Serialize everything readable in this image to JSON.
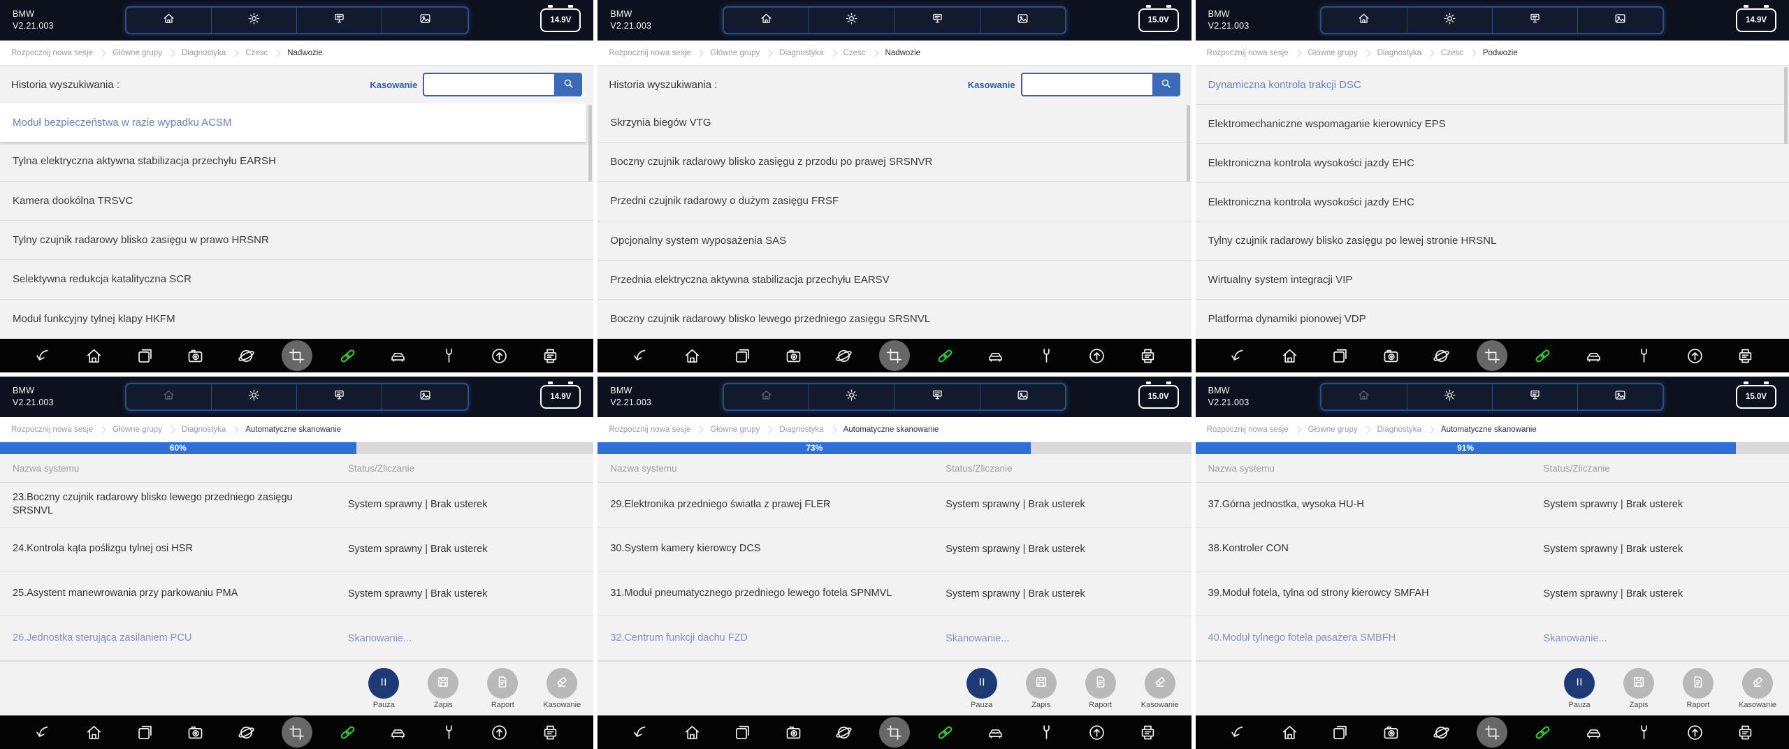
{
  "app": {
    "brand": "BMW",
    "version": "V2.21.003"
  },
  "colors": {
    "header_bg": "#0c111d",
    "accent_blue": "#2c70d8",
    "link_green": "#29cc33",
    "selected_item_text": "#6882b5",
    "pause_button": "#1d3a74",
    "clear_link": "#2d5bb7"
  },
  "shared": {
    "search_label": "Historia wyszukiwania :",
    "clear_label": "Kasowanie",
    "search_value": "",
    "search_placeholder": "",
    "table_header_name": "Nazwa systemu",
    "table_header_status": "Status/Zliczanie",
    "status_ok": "System sprawny | Brak usterek",
    "status_scanning": "Skanowanie...",
    "actions": [
      "Pauza",
      "Zapis",
      "Raport",
      "Kasowanie"
    ],
    "nav_icons": [
      "home-icon",
      "settings-icon",
      "print-icon",
      "gallery-icon"
    ],
    "toolbar_icons": [
      "back-icon",
      "home-icon",
      "windows-icon",
      "camera-icon",
      "browser-icon",
      "crop-icon",
      "link-icon",
      "car-icon",
      "wrench-icon",
      "update-icon",
      "printer-icon"
    ]
  },
  "panels": [
    {
      "battery": "14.9V",
      "breadcrumb": [
        "Rozpocznij nowa sesje",
        "Główne grupy",
        "Diagnostyka",
        "Czesc",
        "Nadwozie"
      ],
      "list": [
        "Moduł bezpieczeństwa w razie wypadku ACSM",
        "Tylna elektryczna aktywna stabilizacja przechyłu EARSH",
        "Kamera dookólna TRSVC",
        "Tylny czujnik radarowy blisko zasięgu w prawo HRSNR",
        "Selektywna redukcja katalityczna SCR",
        "Moduł funkcyjny tylnej klapy HKFM"
      ]
    },
    {
      "battery": "15.0V",
      "breadcrumb": [
        "Rozpocznij nowa sesje",
        "Główne grupy",
        "Diagnostyka",
        "Czesc",
        "Nadwozie"
      ],
      "list": [
        "Skrzynia biegów VTG",
        "Boczny czujnik radarowy blisko zasięgu z przodu po prawej SRSNVR",
        "Przedni czujnik radarowy o dużym zasięgu FRSF",
        "Opcjonalny system wyposażenia SAS",
        "Przednia elektryczna aktywna stabilizacja przechyłu EARSV",
        "Boczny czujnik radarowy blisko lewego przedniego zasięgu SRSNVL"
      ]
    },
    {
      "battery": "14.9V",
      "breadcrumb": [
        "Rozpocznij nowa sesje",
        "Główne grupy",
        "Diagnostyka",
        "Czesc",
        "Podwozie"
      ],
      "list": [
        "Dynamiczna kontrola trakcji DSC",
        "Elektromechaniczne wspomaganie kierownicy EPS",
        "Elektroniczna kontrola wysokości jazdy EHC",
        "Elektroniczna kontrola wysokości jazdy EHC",
        "Tylny czujnik radarowy blisko zasięgu po lewej stronie HRSNL",
        "Wirtualny system integracji VIP",
        "Platforma dynamiki pionowej VDP"
      ]
    },
    {
      "battery": "14.9V",
      "breadcrumb": [
        "Rozpocznij nowa sesje",
        "Główne grupy",
        "Diagnostyka",
        "Automatyczne skanowanie"
      ],
      "progress": "60%",
      "rows": [
        {
          "name": "23.Boczny czujnik radarowy blisko lewego przedniego zasięgu SRSNVL",
          "status": "System sprawny | Brak usterek"
        },
        {
          "name": "24.Kontrola kąta poślizgu tylnej osi HSR",
          "status": "System sprawny | Brak usterek"
        },
        {
          "name": "25.Asystent manewrowania przy parkowaniu PMA",
          "status": "System sprawny | Brak usterek"
        },
        {
          "name": "26.Jednostka sterująca zasilaniem PCU",
          "status": "Skanowanie..."
        }
      ]
    },
    {
      "battery": "15.0V",
      "breadcrumb": [
        "Rozpocznij nowa sesje",
        "Główne grupy",
        "Diagnostyka",
        "Automatyczne skanowanie"
      ],
      "progress": "73%",
      "rows": [
        {
          "name": "29.Elektronika przedniego światła z prawej FLER",
          "status": "System sprawny | Brak usterek"
        },
        {
          "name": "30.System kamery kierowcy DCS",
          "status": "System sprawny | Brak usterek"
        },
        {
          "name": "31.Moduł pneumatycznego przedniego lewego fotela SPNMVL",
          "status": "System sprawny | Brak usterek"
        },
        {
          "name": "32.Centrum funkcji dachu FZD",
          "status": "Skanowanie..."
        }
      ]
    },
    {
      "battery": "15.0V",
      "breadcrumb": [
        "Rozpocznij nowa sesje",
        "Główne grupy",
        "Diagnostyka",
        "Automatyczne skanowanie"
      ],
      "progress": "91%",
      "rows": [
        {
          "name": "37.Górna jednostka, wysoka HU-H",
          "status": "System sprawny | Brak usterek"
        },
        {
          "name": "38.Kontroler CON",
          "status": "System sprawny | Brak usterek"
        },
        {
          "name": "39.Moduł fotela, tylna od strony kierowcy SMFAH",
          "status": "System sprawny | Brak usterek"
        },
        {
          "name": "40.Moduł tylnego fotela pasażera SMBFH",
          "status": "Skanowanie..."
        }
      ]
    }
  ]
}
